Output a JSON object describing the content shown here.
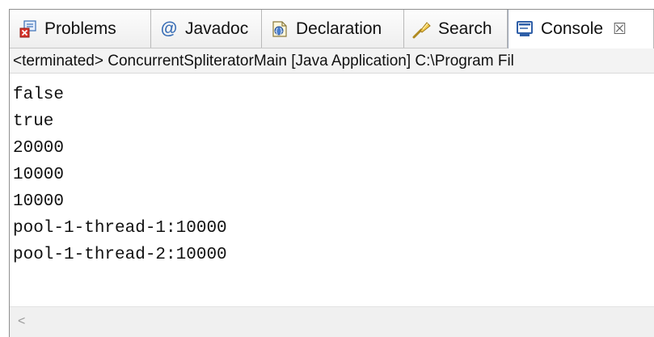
{
  "tabs": [
    {
      "label": "Problems",
      "icon": "problems-icon"
    },
    {
      "label": "Javadoc",
      "icon": "javadoc-icon"
    },
    {
      "label": "Declaration",
      "icon": "declaration-icon"
    },
    {
      "label": "Search",
      "icon": "search-icon"
    },
    {
      "label": "Console",
      "icon": "console-icon",
      "active": true,
      "close_glyph": "☒"
    }
  ],
  "status_text": "<terminated> ConcurrentSpliteratorMain [Java Application] C:\\Program Fil",
  "console_lines": [
    "false",
    "true",
    "20000",
    "10000",
    "10000",
    "pool-1-thread-1:10000",
    "pool-1-thread-2:10000"
  ],
  "scrollbar": {
    "left_arrow": "<"
  },
  "colors": {
    "active_tab_bg": "#ffffff",
    "tabbar_bg": "#eeeeee",
    "status_bg": "#f3f3f3",
    "icon_blue": "#2f5fa8"
  }
}
